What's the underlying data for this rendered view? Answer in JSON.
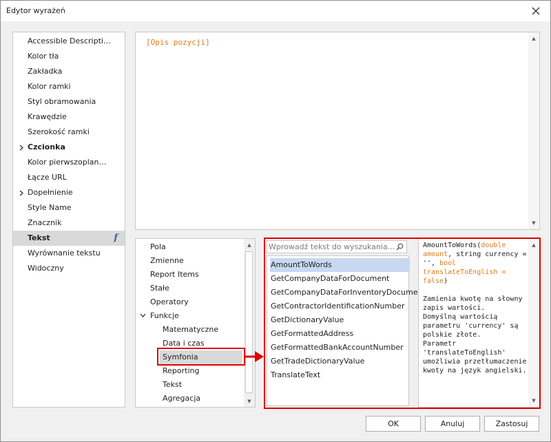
{
  "window": {
    "title": "Edytor wyrażeń"
  },
  "properties": {
    "items": [
      {
        "label": "Accessible Descripti…",
        "bold": false,
        "chevron": false,
        "selected": false
      },
      {
        "label": "Kolor tła",
        "bold": false,
        "chevron": false,
        "selected": false
      },
      {
        "label": "Zakładka",
        "bold": false,
        "chevron": false,
        "selected": false
      },
      {
        "label": "Kolor ramki",
        "bold": false,
        "chevron": false,
        "selected": false
      },
      {
        "label": "Styl obramowania",
        "bold": false,
        "chevron": false,
        "selected": false
      },
      {
        "label": "Krawędzie",
        "bold": false,
        "chevron": false,
        "selected": false
      },
      {
        "label": "Szerokość ramki",
        "bold": false,
        "chevron": false,
        "selected": false
      },
      {
        "label": "Czcionka",
        "bold": true,
        "chevron": true,
        "selected": false
      },
      {
        "label": "Kolor pierwszoplan…",
        "bold": false,
        "chevron": false,
        "selected": false
      },
      {
        "label": "Łącze URL",
        "bold": false,
        "chevron": false,
        "selected": false
      },
      {
        "label": "Dopełnienie",
        "bold": false,
        "chevron": true,
        "selected": false
      },
      {
        "label": "Style Name",
        "bold": false,
        "chevron": false,
        "selected": false
      },
      {
        "label": "Znacznik",
        "bold": false,
        "chevron": false,
        "selected": false
      },
      {
        "label": "Tekst",
        "bold": true,
        "chevron": false,
        "selected": true,
        "fx": "f"
      },
      {
        "label": "Wyrównanie tekstu",
        "bold": false,
        "chevron": false,
        "selected": false
      },
      {
        "label": "Widoczny",
        "bold": false,
        "chevron": false,
        "selected": false
      }
    ]
  },
  "editor": {
    "text": "[Opis pozycji]"
  },
  "categories": {
    "items": [
      {
        "label": "Pola",
        "indent": 0
      },
      {
        "label": "Zmienne",
        "indent": 0
      },
      {
        "label": "Report Items",
        "indent": 0
      },
      {
        "label": "Stałe",
        "indent": 0
      },
      {
        "label": "Operatory",
        "indent": 0
      },
      {
        "label": "Funkcje",
        "indent": 0,
        "expanded": true
      },
      {
        "label": "Matematyczne",
        "indent": 1
      },
      {
        "label": "Data i czas",
        "indent": 1
      },
      {
        "label": "Symfonia",
        "indent": 1,
        "selected": true
      },
      {
        "label": "Reporting",
        "indent": 1
      },
      {
        "label": "Tekst",
        "indent": 1
      },
      {
        "label": "Agregacja",
        "indent": 1
      }
    ]
  },
  "search": {
    "placeholder": "Wprowadź tekst do wyszukania..."
  },
  "functions": {
    "items": [
      "AmountToWords",
      "GetCompanyDataForDocument",
      "GetCompanyDataForInventoryDocument",
      "GetContractorIdentificationNumber",
      "GetDictionaryValue",
      "GetFormattedAddress",
      "GetFormattedBankAccountNumber",
      "GetTradeDictionaryValue",
      "TranslateText"
    ],
    "selected_index": 0
  },
  "description": {
    "sig_name": "AmountToWords(",
    "sig_p1": "double amount",
    "sig_p2": ", string currency = '', ",
    "sig_p3": "bool translateToEnglish = false",
    "sig_close": ")",
    "body": "Zamienia kwotę na słowny zapis wartości.\nDomyślną wartością parametru 'currency' są polskie złote.\nParametr 'translateToEnglish' umożliwia przetłumaczenie kwoty na język angielski."
  },
  "buttons": {
    "ok": "OK",
    "cancel": "Anuluj",
    "apply": "Zastosuj"
  },
  "colors": {
    "highlight": "#e00000",
    "keyword": "#e07a1c",
    "selection": "#c8d8f0"
  }
}
